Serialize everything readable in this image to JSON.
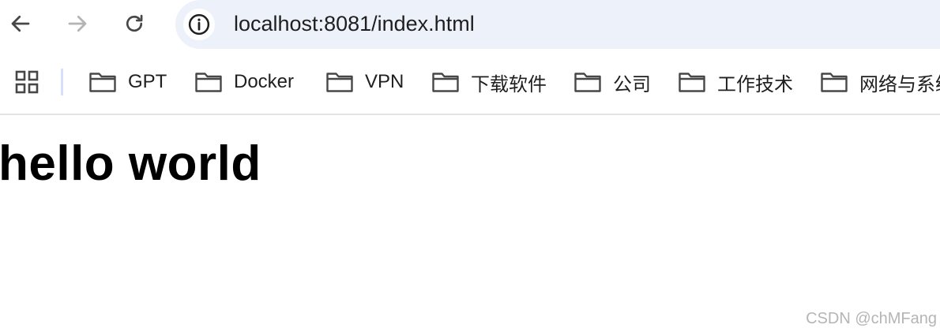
{
  "toolbar": {
    "back_icon": "arrow-left-icon",
    "forward_icon": "arrow-right-icon",
    "reload_icon": "reload-icon",
    "site_info_icon": "info-icon",
    "url": "localhost:8081/index.html",
    "omnibox_bg": "#edf2fa"
  },
  "bookmarks": {
    "apps_icon": "apps-grid-icon",
    "items": [
      {
        "label": "GPT",
        "icon": "folder-icon"
      },
      {
        "label": "Docker",
        "icon": "folder-icon"
      },
      {
        "label": "VPN",
        "icon": "folder-icon"
      },
      {
        "label": "下载软件",
        "icon": "folder-icon"
      },
      {
        "label": "公司",
        "icon": "folder-icon"
      },
      {
        "label": "工作技术",
        "icon": "folder-icon"
      },
      {
        "label": "网络与系统",
        "icon": "folder-icon"
      }
    ]
  },
  "page": {
    "heading": "hello world"
  },
  "watermark": "CSDN @chMFang"
}
